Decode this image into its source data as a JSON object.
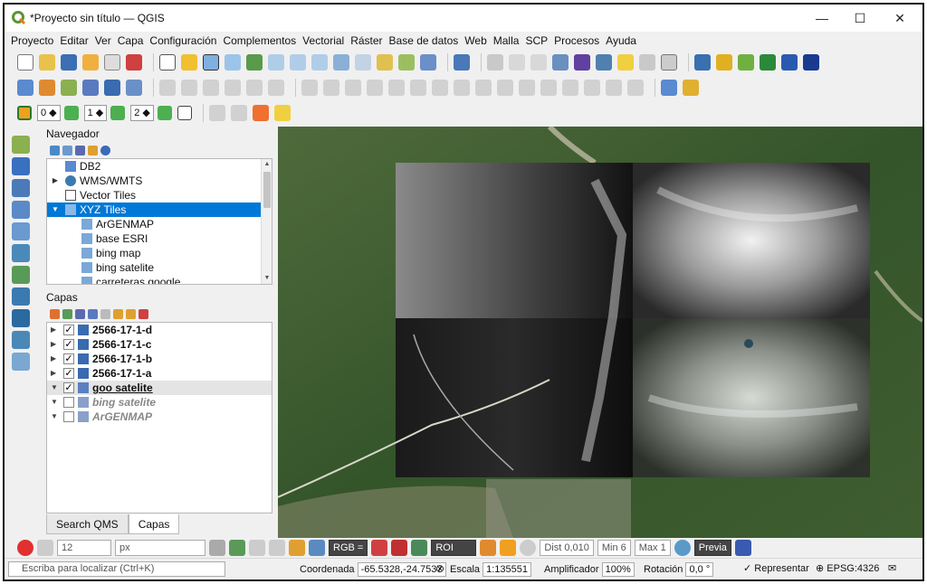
{
  "window": {
    "title": "*Proyecto sin título — QGIS",
    "minimize": "—",
    "maximize": "☐",
    "close": "✕"
  },
  "menu": [
    "Proyecto",
    "Editar",
    "Ver",
    "Capa",
    "Configuración",
    "Complementos",
    "Vectorial",
    "Ráster",
    "Base de datos",
    "Web",
    "Malla",
    "SCP",
    "Procesos",
    "Ayuda"
  ],
  "toolbar3": {
    "spin1": "0",
    "spin2": "1",
    "spin3": "2"
  },
  "navigator": {
    "title": "Navegador",
    "items": [
      {
        "label": "DB2",
        "icon": "db2-icon"
      },
      {
        "label": "WMS/WMTS",
        "icon": "wms-icon"
      },
      {
        "label": "Vector Tiles",
        "icon": "vector-tiles-icon"
      },
      {
        "label": "XYZ Tiles",
        "icon": "xyz-tiles-icon"
      },
      {
        "label": "ArGENMAP",
        "icon": "tile-grid-icon"
      },
      {
        "label": "base ESRI",
        "icon": "tile-grid-icon"
      },
      {
        "label": "bing map",
        "icon": "tile-grid-icon"
      },
      {
        "label": "bing satelite",
        "icon": "tile-grid-icon"
      },
      {
        "label": "carreteras google",
        "icon": "tile-grid-icon"
      }
    ]
  },
  "layers": {
    "title": "Capas",
    "items": [
      {
        "label": "2566-17-1-d",
        "checked": "✓"
      },
      {
        "label": "2566-17-1-c",
        "checked": "✓"
      },
      {
        "label": "2566-17-1-b",
        "checked": "✓"
      },
      {
        "label": "2566-17-1-a",
        "checked": "✓"
      },
      {
        "label": "goo satelite",
        "checked": "✓"
      },
      {
        "label": "bing satelite",
        "checked": ""
      },
      {
        "label": "ArGENMAP",
        "checked": ""
      }
    ],
    "tabs": [
      "Search QMS",
      "Capas"
    ]
  },
  "bottom_toolbar": {
    "size_value": "12",
    "unit": "px",
    "rgb": "RGB =",
    "roi": "ROI",
    "dist": "Dist 0,010",
    "min": "Min 6",
    "max": "Max 1",
    "preview": "Previa"
  },
  "status": {
    "locate_placeholder": "Escriba para localizar (Ctrl+K)",
    "coord_label": "Coordenada",
    "coord_value": "-65.5328,-24.7537",
    "scale_label": "Escala",
    "scale_value": "1:135551",
    "magnifier_label": "Amplificador",
    "magnifier_value": "100%",
    "rotation_label": "Rotación",
    "rotation_value": "0,0 °",
    "render_label": "Representar",
    "crs": "EPSG:4326"
  },
  "colors": {
    "accent": "#0078d7",
    "qgis_green": "#589632",
    "map_green": "#3a5a2c"
  }
}
